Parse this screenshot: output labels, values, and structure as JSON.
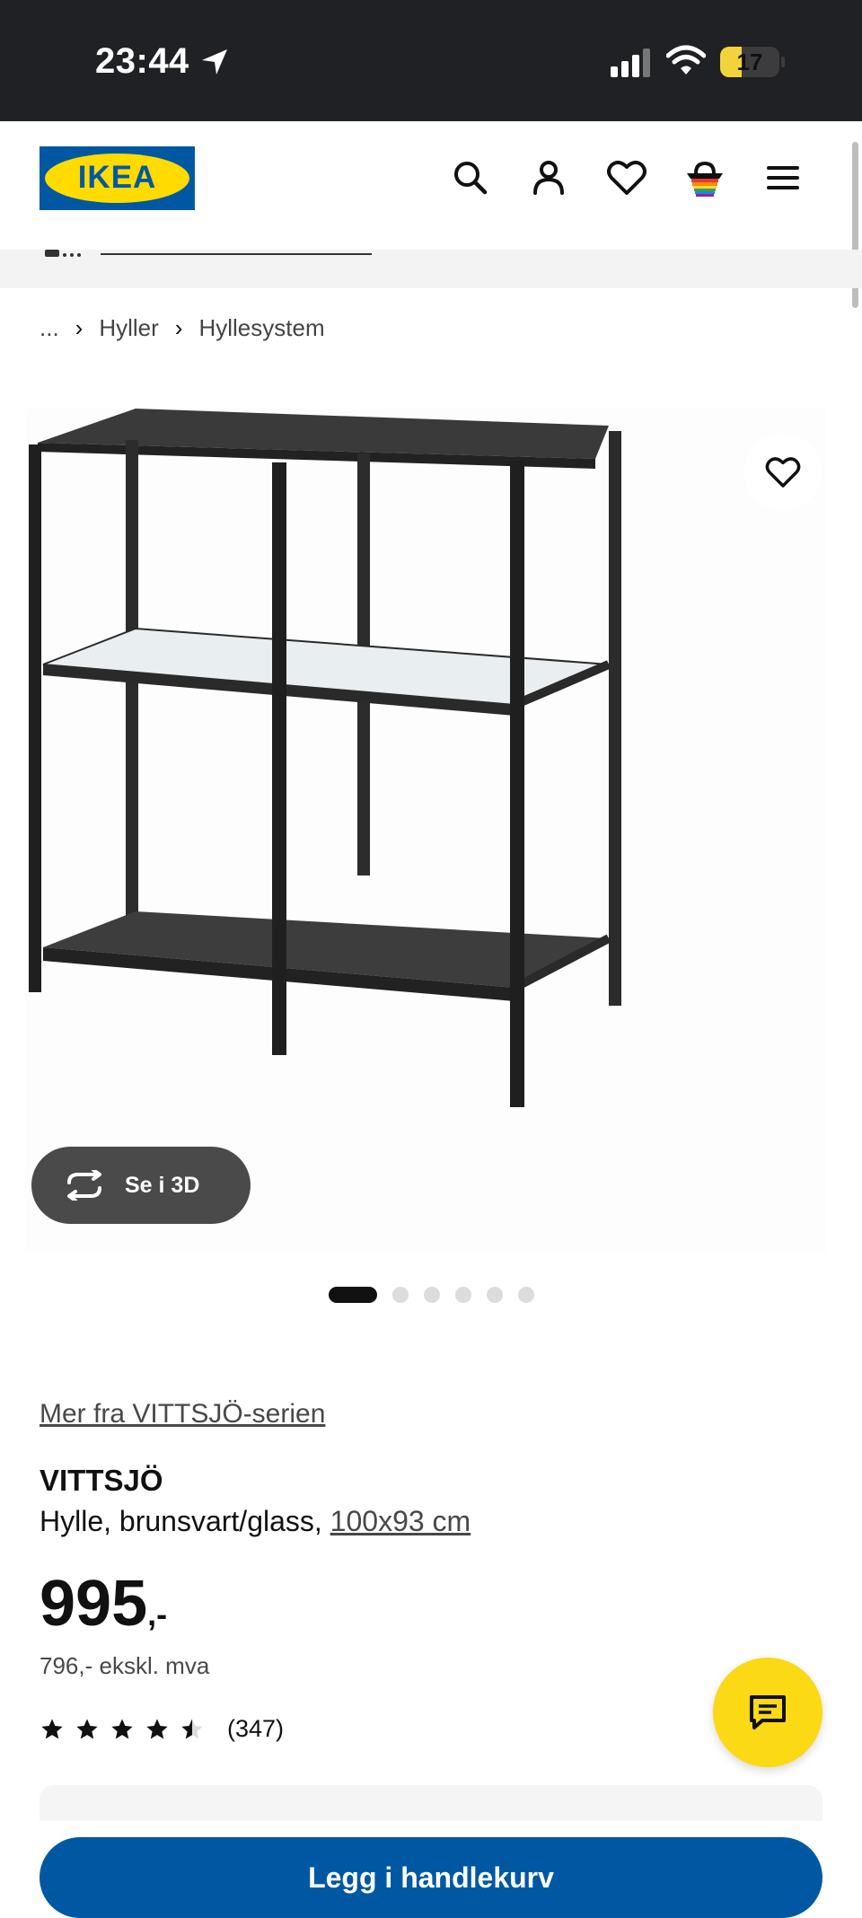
{
  "status_bar": {
    "time": "23:44",
    "battery": "17"
  },
  "header": {
    "logo_text": "IKEA"
  },
  "breadcrumb": {
    "ellipsis": "...",
    "items": [
      "Hyller",
      "Hyllesystem"
    ]
  },
  "gallery": {
    "view_3d_label": "Se i 3D",
    "total_images": 6,
    "active_index": 0
  },
  "product": {
    "series_link": "Mer fra VITTSJÖ-serien",
    "name": "VITTSJÖ",
    "description": "Hylle, brunsvart/glass, ",
    "dimensions": "100x93 cm",
    "price_main": "995",
    "price_suffix": ",-",
    "price_ex_vat": "796,- ekskl. mva",
    "rating_value": 4.5,
    "review_count": "(347)"
  },
  "actions": {
    "add_to_cart": "Legg i handlekurv"
  },
  "colors": {
    "brand_blue": "#0058a3",
    "brand_yellow": "#ffdb00",
    "chat_yellow": "#fbd914",
    "status_bar": "#202125"
  }
}
